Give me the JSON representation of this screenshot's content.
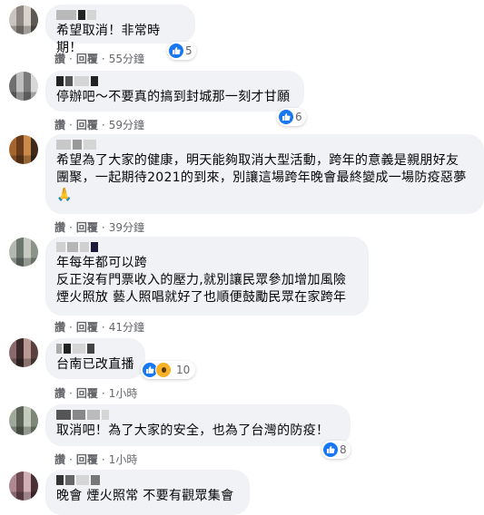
{
  "actions": {
    "like": "讚",
    "reply": "回覆",
    "dot": "·"
  },
  "comments": [
    {
      "text": "希望取消！非常時期！",
      "time": "55分鐘",
      "reaction_count": "5"
    },
    {
      "text": "停辦吧～不要真的搞到封城那一刻才甘願",
      "time": "59分鐘",
      "reaction_count": "6"
    },
    {
      "text": "希望為了大家的健康，明天能夠取消大型活動，跨年的意義是親朋好友\n團聚，一起期待2021的到來，別讓這場跨年晚會最終變成一場防疫惡夢\n🙏",
      "time": "39分鐘",
      "reaction_count": ""
    },
    {
      "text": "年每年都可以跨\n反正沒有門票收入的壓力,就別讓民眾參加增加風險\n煙火照放 藝人照唱就好了也順便鼓勵民眾在家跨年",
      "time": "41分鐘",
      "reaction_count": ""
    },
    {
      "text": "台南已改直播",
      "time": "1小時",
      "reaction_count": "10"
    },
    {
      "text": "取消吧！為了大家的安全，也為了台灣的防疫！",
      "time": "1小時",
      "reaction_count": "8"
    },
    {
      "text": "晚會 煙火照常 不要有觀眾集會",
      "time": "",
      "reaction_count": ""
    }
  ],
  "colors": {
    "bubble": "#f0f2f5",
    "meta_text": "#65676b",
    "like_blue": "#1877f2",
    "wow_yellow": "#f7b125"
  }
}
